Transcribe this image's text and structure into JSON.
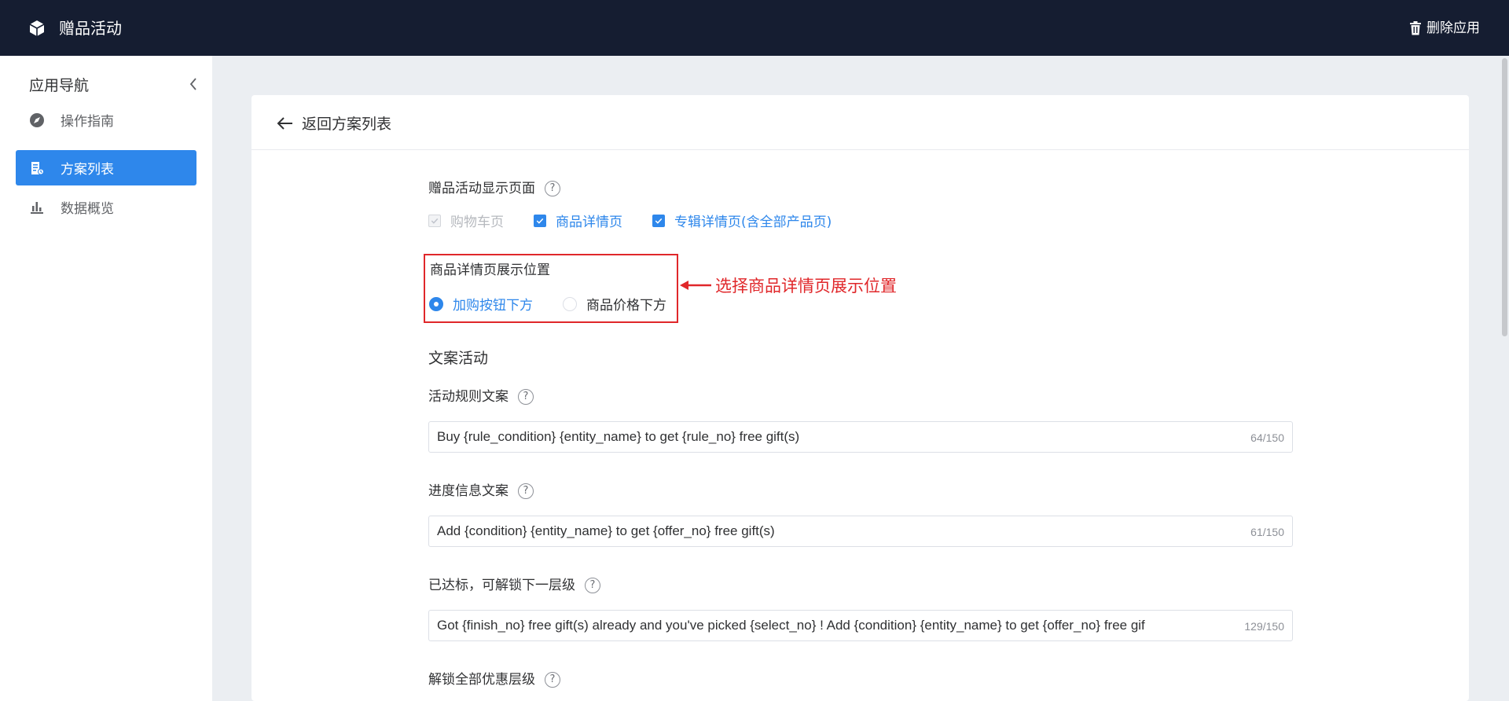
{
  "app": {
    "title": "赠品活动",
    "delete_label": "删除应用"
  },
  "sidebar": {
    "title": "应用导航",
    "items": [
      {
        "label": "操作指南",
        "icon": "compass-icon",
        "active": false
      },
      {
        "label": "方案列表",
        "icon": "document-list-icon",
        "active": true
      },
      {
        "label": "数据概览",
        "icon": "bar-chart-icon",
        "active": false
      }
    ]
  },
  "main": {
    "back_label": "返回方案列表",
    "display_page": {
      "label": "赠品活动显示页面",
      "options": [
        {
          "label": "购物车页",
          "checked": true,
          "disabled": true
        },
        {
          "label": "商品详情页",
          "checked": true,
          "disabled": false
        },
        {
          "label": "专辑详情页(含全部产品页)",
          "checked": true,
          "disabled": false
        }
      ]
    },
    "detail_position": {
      "label": "商品详情页展示位置",
      "options": [
        {
          "label": "加购按钮下方",
          "selected": true
        },
        {
          "label": "商品价格下方",
          "selected": false
        }
      ]
    },
    "annotation": "选择商品详情页展示位置",
    "copy_section": {
      "title": "文案活动",
      "fields": [
        {
          "label": "活动规则文案",
          "value": "Buy {rule_condition} {entity_name} to get {rule_no} free gift(s)",
          "count": "64/150"
        },
        {
          "label": "进度信息文案",
          "value": "Add {condition} {entity_name}  to get {offer_no} free gift(s)",
          "count": "61/150"
        },
        {
          "label": "已达标，可解锁下一层级",
          "value": "Got {finish_no} free gift(s) already and you've picked {select_no} ! Add {condition} {entity_name} to get {offer_no} free gif",
          "count": "129/150"
        },
        {
          "label": "解锁全部优惠层级"
        }
      ]
    }
  },
  "colors": {
    "topbar": "#151d31",
    "accent": "#2e87eb",
    "annotation": "#e0272a",
    "page_bg": "#ebeef2"
  }
}
